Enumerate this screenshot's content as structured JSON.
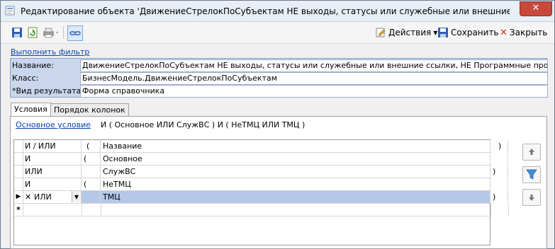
{
  "window": {
    "title": "Редактирование объекта 'ДвижениеСтрелокПоСубъектам НЕ выходы, статусы или служебные или внешние ссылки, НЕ Прог..."
  },
  "toolbar": {
    "actions_label": "Действия",
    "save_label": "Сохранить",
    "close_label": "Закрыть"
  },
  "filter_link": "Выполнить фильтр",
  "properties": {
    "name_label": "Название:",
    "name_value": "ДвижениеСтрелокПоСубъектам НЕ выходы, статусы или служебные или внешние ссылки, НЕ Программные продукты",
    "class_label": "Класс:",
    "class_value": "БизнесМодель.ДвижениеСтрелокПоСубъектам",
    "result_label": "*Вид результата:",
    "result_value": "Форма справочника"
  },
  "tabs": [
    "Условия",
    "Порядок колонок"
  ],
  "condition": {
    "link": "Основное условие",
    "expression": "И ( Основное  ИЛИ  СлужВС ) И ( НеТМЦ  ИЛИ  ТМЦ )"
  },
  "grid": {
    "headers": [
      "И / ИЛИ",
      "(",
      "Название",
      ")"
    ],
    "rows": [
      {
        "op": "И",
        "open": "(",
        "name": "Основное",
        "close": ""
      },
      {
        "op": "ИЛИ",
        "open": "",
        "name": "СлужВС",
        "close": ")"
      },
      {
        "op": "И",
        "open": "(",
        "name": "НеТМЦ",
        "close": ""
      },
      {
        "op": "ИЛИ",
        "open": "",
        "name": "ТМЦ",
        "close": ")"
      }
    ],
    "new_row_marker": "*"
  }
}
